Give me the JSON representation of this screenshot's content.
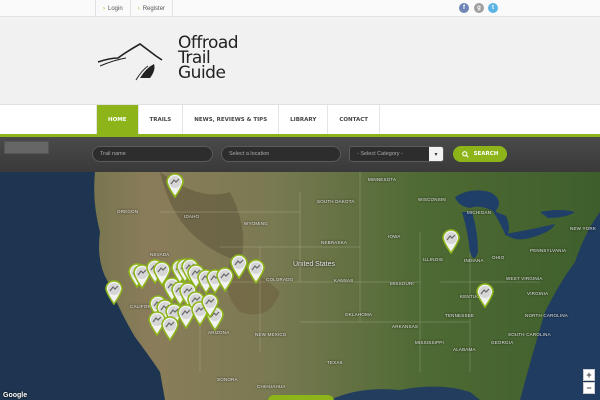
{
  "topbar": {
    "login_label": "Login",
    "register_label": "Register",
    "social": [
      {
        "icon": "facebook-icon",
        "glyph": "f",
        "color": "#6d86b6"
      },
      {
        "icon": "google-plus-icon",
        "glyph": "g",
        "color": "#9e9e9e"
      },
      {
        "icon": "twitter-icon",
        "glyph": "t",
        "color": "#5bb4e3"
      }
    ]
  },
  "logo": {
    "line1": "Offroad",
    "line2": "Trail",
    "line3": "Guide"
  },
  "nav": {
    "items": [
      "HOME",
      "TRAILS",
      "NEWS, REVIEWS & TIPS",
      "LIBRARY",
      "CONTACT"
    ],
    "active": "HOME",
    "accent": "#8db51a"
  },
  "search": {
    "trail_placeholder": "Trail name",
    "location_placeholder": "Select a location",
    "category_value": "- Select Category -",
    "button_label": "SEARCH"
  },
  "map": {
    "country_label": "United States",
    "states": [
      "MINNESOTA",
      "WISCONSIN",
      "MICHIGAN",
      "OREGON",
      "IDAHO",
      "WYOMING",
      "SOUTH DAKOTA",
      "NEBRASKA",
      "IOWA",
      "ILLINOIS",
      "INDIANA",
      "OHIO",
      "PENNSYLVANIA",
      "NEW YORK",
      "WEST VIRGINIA",
      "VIRGINIA",
      "KANSAS",
      "MISSOURI",
      "KENTUCKY",
      "COLORADO",
      "UTAH",
      "NEVADA",
      "CALIFORNIA",
      "ARIZONA",
      "NEW MEXICO",
      "OKLAHOMA",
      "ARKANSAS",
      "TENNESSEE",
      "NORTH CAROLINA",
      "SOUTH CAROLINA",
      "MISSISSIPPI",
      "ALABAMA",
      "GEORGIA",
      "TEXAS",
      "SONORA",
      "CHIHUAHUA"
    ],
    "zoom_in": "+",
    "zoom_out": "−",
    "attribution": "Google"
  }
}
